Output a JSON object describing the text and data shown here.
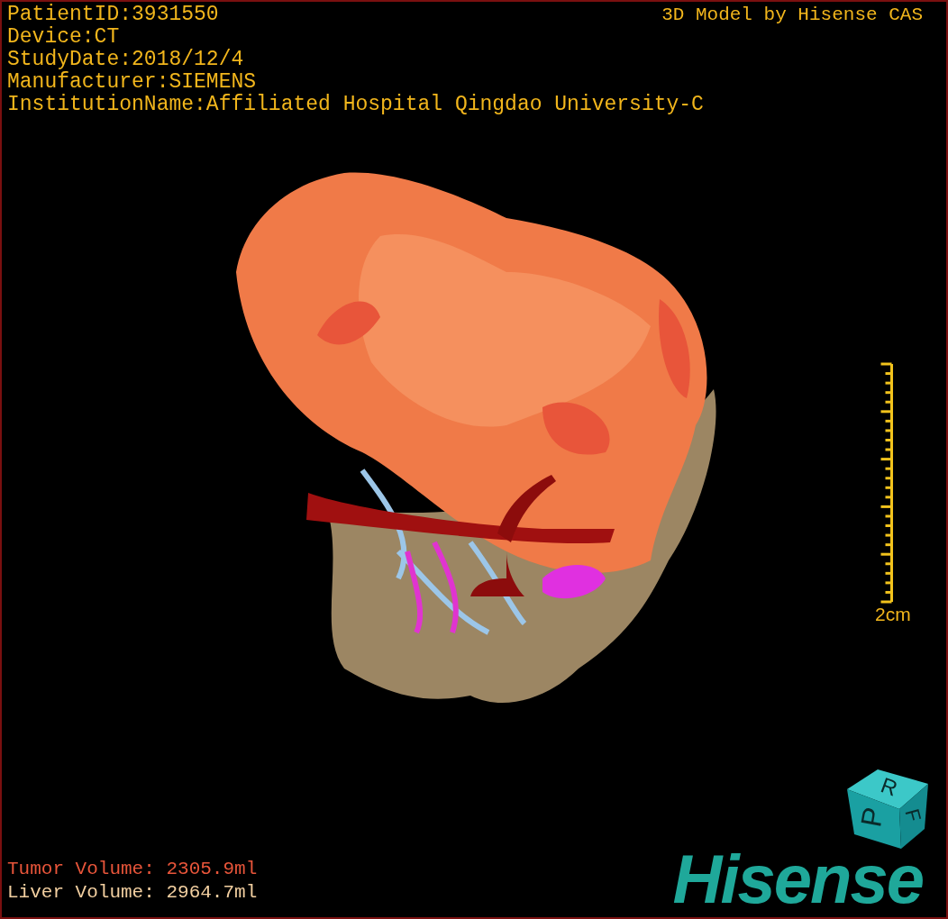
{
  "info_lines": [
    "PatientID:3931550",
    "Device:CT",
    "StudyDate:2018/12/4",
    "Manufacturer:SIEMENS",
    "InstitutionName:Affiliated Hospital Qingdao University-C"
  ],
  "credit": "3D Model by Hisense CAS",
  "scale_bar": {
    "label": "2cm"
  },
  "orientation_cube": {
    "labels": [
      "P",
      "R",
      "F"
    ]
  },
  "volumes": [
    {
      "label": "Tumor Volume:",
      "value": "2305.9ml",
      "color": "#e8553a"
    },
    {
      "label": "Liver Volume:",
      "value": "2964.7ml",
      "color": "#f2cfa0"
    }
  ],
  "logo": "Hisense"
}
